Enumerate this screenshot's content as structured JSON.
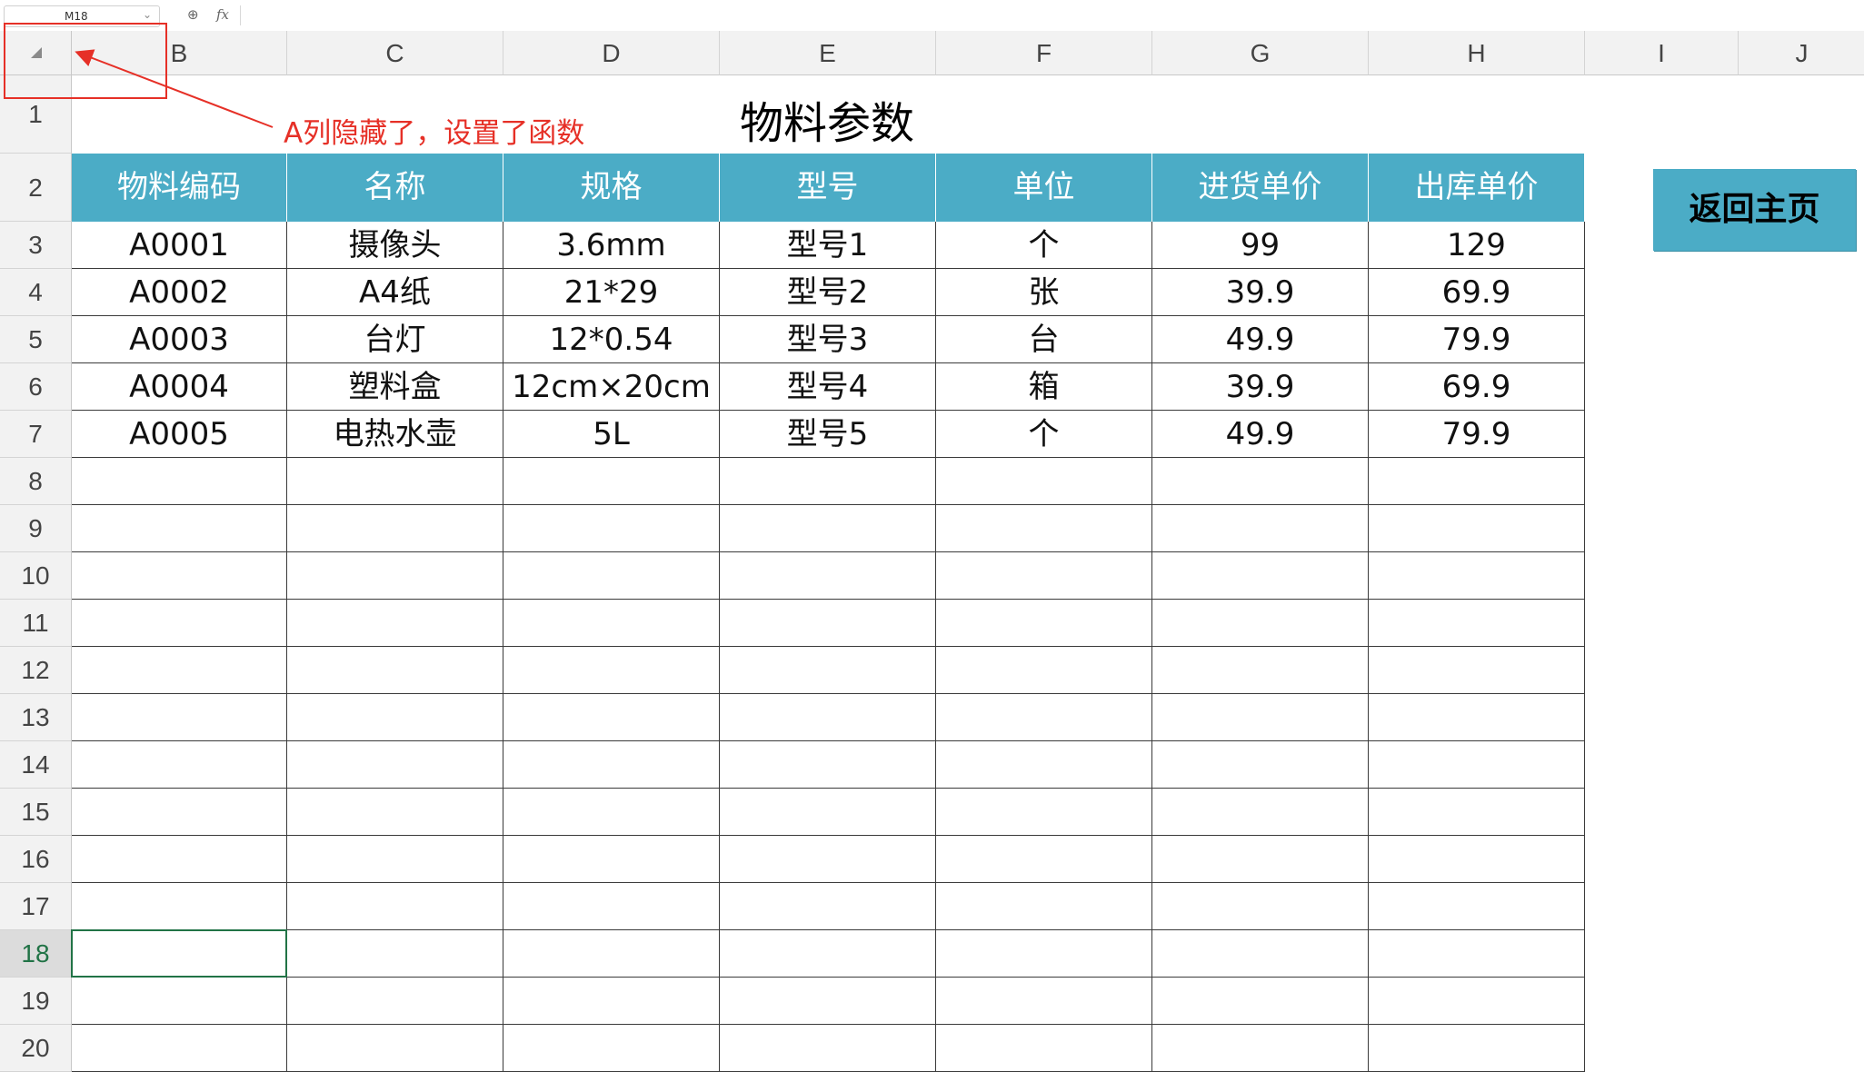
{
  "formula_bar": {
    "name_box": "M18",
    "fx_label": "fx",
    "formula": ""
  },
  "column_headers": [
    "B",
    "C",
    "D",
    "E",
    "F",
    "G",
    "H",
    "I",
    "J"
  ],
  "row_headers": [
    "1",
    "2",
    "3",
    "4",
    "5",
    "6",
    "7",
    "8",
    "9",
    "10",
    "11",
    "12",
    "13",
    "14",
    "15",
    "16",
    "17",
    "18",
    "19",
    "20"
  ],
  "selected_row": "18",
  "sheet": {
    "title": "物料参数",
    "table_headers": [
      "物料编码",
      "名称",
      "规格",
      "型号",
      "单位",
      "进货单价",
      "出库单价"
    ],
    "rows": [
      [
        "A0001",
        "摄像头",
        "3.6mm",
        "型号1",
        "个",
        "99",
        "129"
      ],
      [
        "A0002",
        "A4纸",
        "21*29",
        "型号2",
        "张",
        "39.9",
        "69.9"
      ],
      [
        "A0003",
        "台灯",
        "12*0.54",
        "型号3",
        "台",
        "49.9",
        "79.9"
      ],
      [
        "A0004",
        "塑料盒",
        "12cm×20cm",
        "型号4",
        "箱",
        "39.9",
        "69.9"
      ],
      [
        "A0005",
        "电热水壶",
        "5L",
        "型号5",
        "个",
        "49.9",
        "79.9"
      ]
    ],
    "empty_rows": 13
  },
  "home_button": {
    "label": "返回主页"
  },
  "annotation": {
    "text": "A列隐藏了，设置了函数"
  },
  "colors": {
    "header_fill": "#4bacc6",
    "header_text": "#ffffff",
    "annotation": "#e63027",
    "selected_row_text": "#217346"
  }
}
